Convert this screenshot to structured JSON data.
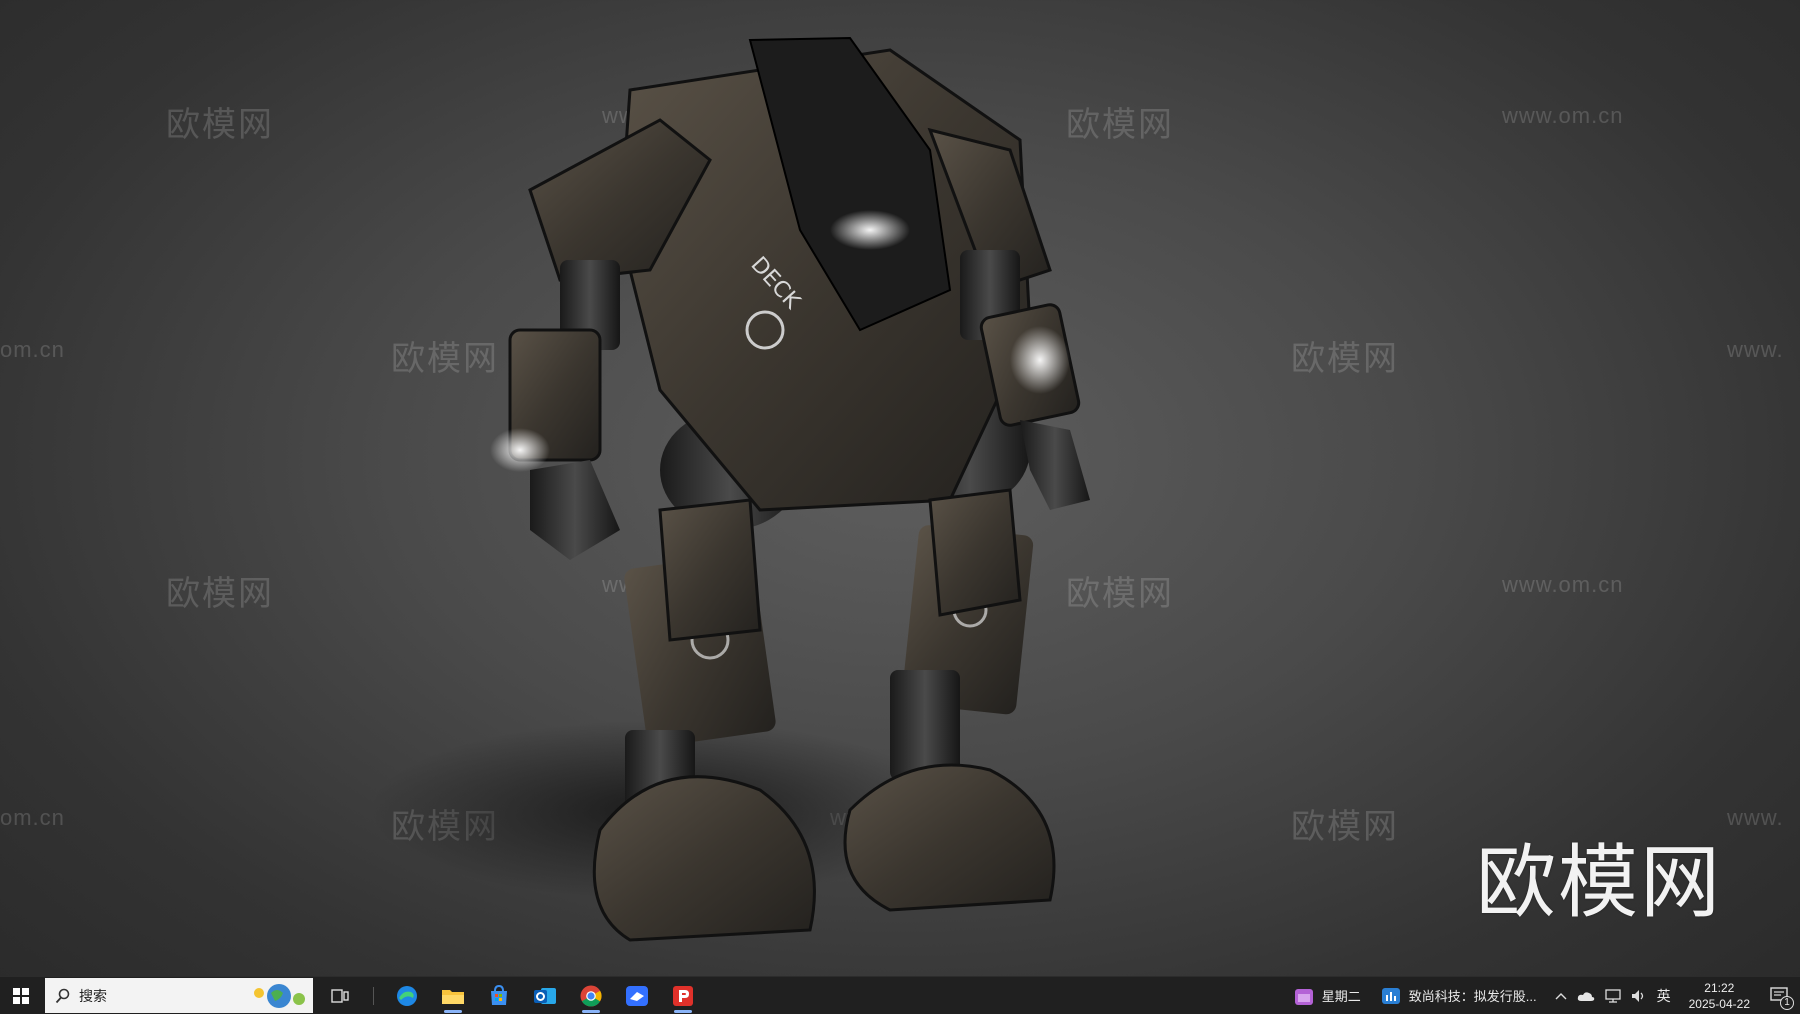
{
  "watermarks": {
    "cn": "欧模网",
    "url": "www.om.cn",
    "url_partial": "om.cn",
    "url_lead": "www."
  },
  "brand_logo": "欧模网",
  "model": {
    "chest_text": "DECK"
  },
  "taskbar": {
    "search_placeholder": "搜索",
    "widget_day": "星期二",
    "news_text": "致尚科技：拟发行股...",
    "ime_indicator": "英",
    "time": "21:22",
    "date": "2025-04-22",
    "notification_count": "1",
    "colors": {
      "bar": "#202020",
      "search_bg": "#f3f3f3",
      "active_indicator": "#8ab4f8"
    },
    "pinned_icons": [
      "task-view-icon",
      "edge-icon",
      "file-explorer-icon",
      "microsoft-store-icon",
      "outlook-icon",
      "chrome-icon",
      "feishu-icon",
      "wps-presentation-icon"
    ]
  }
}
